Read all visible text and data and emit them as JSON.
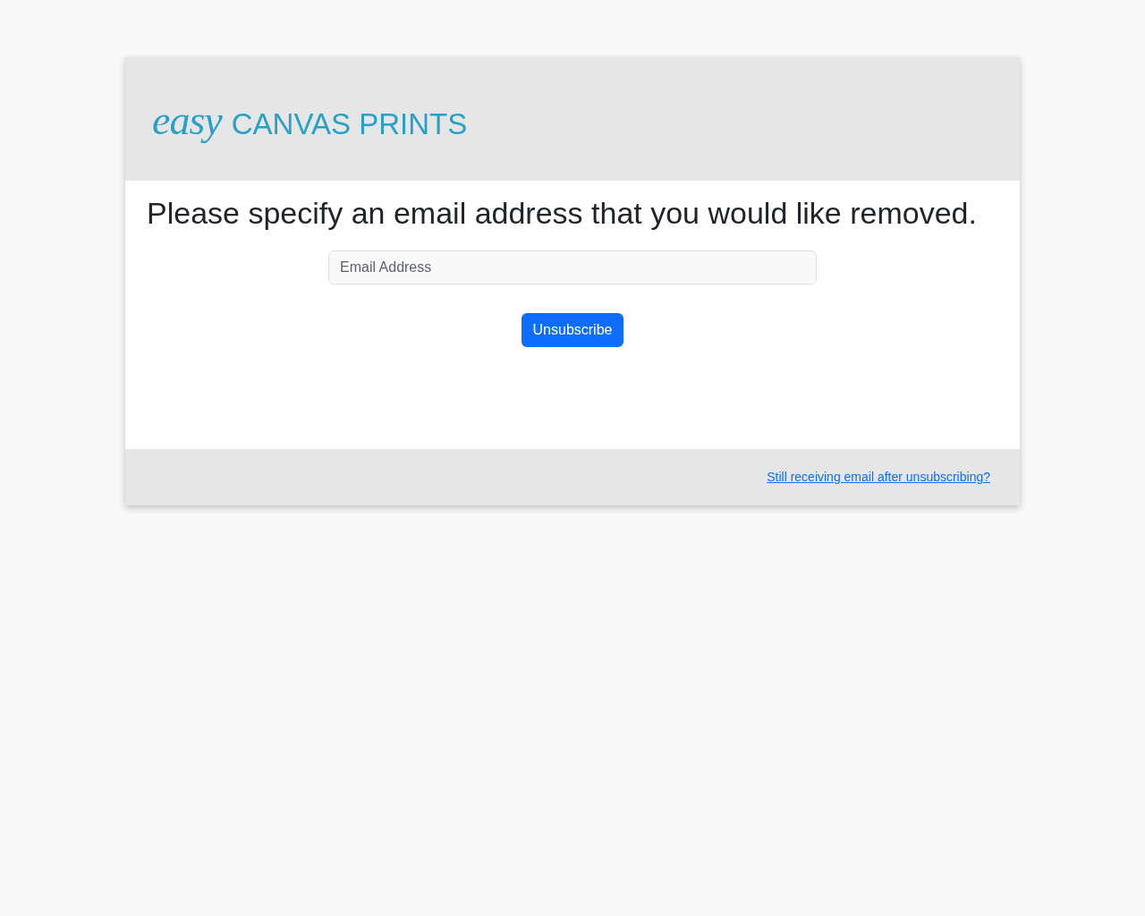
{
  "logo": {
    "script": "easy",
    "wordmark": "CANVAS PRINTS"
  },
  "heading": "Please specify an email address that you would like removed.",
  "email_field": {
    "placeholder": "Email Address"
  },
  "submit_button": {
    "label": "Unsubscribe"
  },
  "footer": {
    "help_link": "Still receiving email after unsubscribing?"
  }
}
